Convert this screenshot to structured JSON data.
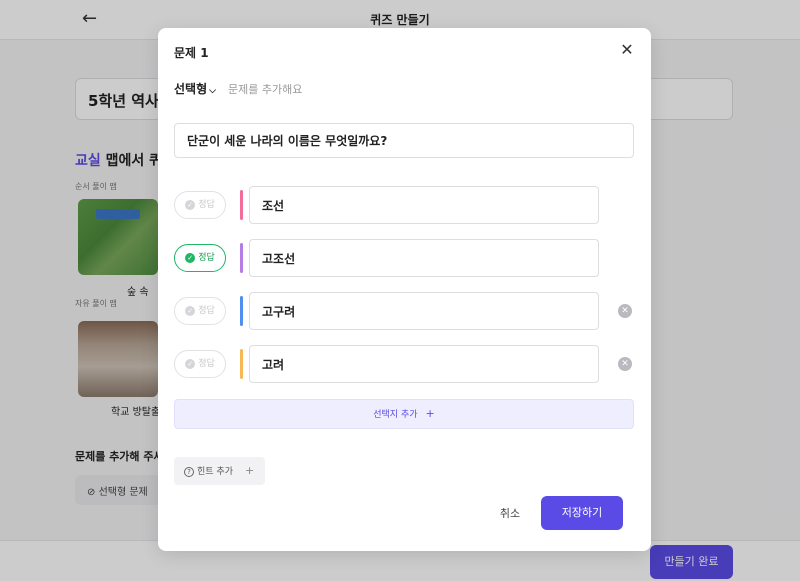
{
  "header": {
    "back_icon": "arrow-left-icon",
    "title": "퀴즈 만들기"
  },
  "background": {
    "quiz_title": "5학년 역사",
    "section_accent": "교실",
    "section_title": " 맵에서 퀴",
    "order_map_label": "순서 풀이 맵",
    "forest_label": "숲 속",
    "free_map_label": "자유 풀이 맵",
    "school_label": "학교 방탈출",
    "add_topic_label": "문제를 추가해 주세요",
    "choice_chip": "선택형 문제",
    "finish_button": "만들기 완료"
  },
  "modal": {
    "title": "문제 1",
    "type_label": "선택형",
    "type_hint": "문제를 추가해요",
    "question_value": "단군이 세운 나라의 이름은 무엇일까요?",
    "answer_label": "정답",
    "answers": [
      {
        "value": "조선",
        "correct": false,
        "color": "#f26d9c"
      },
      {
        "value": "고조선",
        "correct": true,
        "color": "#b57ce6"
      },
      {
        "value": "고구려",
        "correct": false,
        "color": "#4f8ff0"
      },
      {
        "value": "고려",
        "correct": false,
        "color": "#f7b955"
      }
    ],
    "add_choice": "선택지 추가",
    "add_hint": "힌트 추가",
    "cancel": "취소",
    "save": "저장하기"
  }
}
